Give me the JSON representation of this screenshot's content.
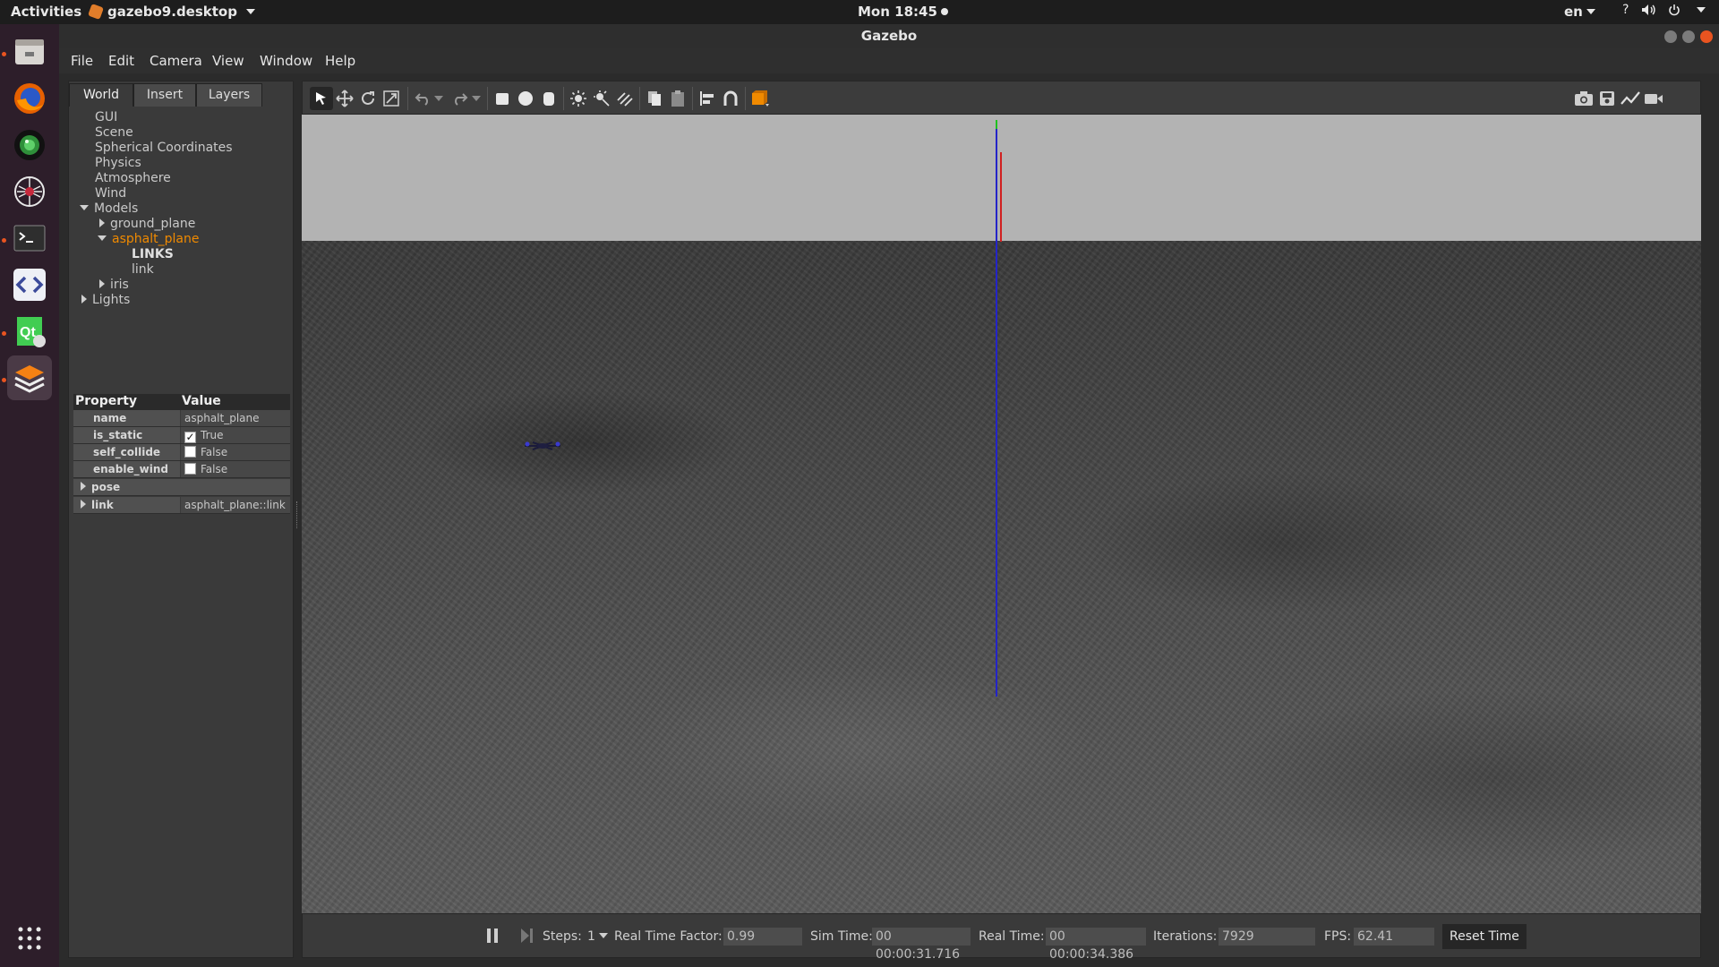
{
  "topbar": {
    "activities": "Activities",
    "app_name": "gazebo9.desktop",
    "clock": "Mon 18:45",
    "lang": "en",
    "help": "?"
  },
  "dock": {
    "items": [
      "files-icon",
      "firefox-icon",
      "camera-app-icon",
      "network-tool-icon",
      "terminal-icon",
      "code-editor-icon",
      "qt-creator-icon",
      "gazebo-icon"
    ],
    "show_apps": "show-applications-icon"
  },
  "window": {
    "title": "Gazebo"
  },
  "menu": [
    "File",
    "Edit",
    "Camera",
    "View",
    "Window",
    "Help"
  ],
  "left_panel": {
    "tabs": [
      "World",
      "Insert",
      "Layers"
    ],
    "tree": {
      "gui": "GUI",
      "scene": "Scene",
      "spherical": "Spherical Coordinates",
      "physics": "Physics",
      "atmosphere": "Atmosphere",
      "wind": "Wind",
      "models": "Models",
      "ground_plane": "ground_plane",
      "asphalt_plane": "asphalt_plane",
      "links_header": "LINKS",
      "link": "link",
      "iris": "iris",
      "lights": "Lights"
    },
    "properties": {
      "header_property": "Property",
      "header_value": "Value",
      "rows": [
        {
          "name": "name",
          "value": "asphalt_plane"
        },
        {
          "name": "is_static",
          "value": "True",
          "checked": "✓"
        },
        {
          "name": "self_collide",
          "value": "False"
        },
        {
          "name": "enable_wind",
          "value": "False"
        },
        {
          "name": "pose",
          "value": ""
        },
        {
          "name": "link",
          "value": "asphalt_plane::link"
        }
      ]
    }
  },
  "toolbar": {
    "left_icons": [
      "select-arrow-icon",
      "translate-icon",
      "rotate-icon",
      "scale-icon",
      "undo-icon",
      "redo-icon",
      "box-shape-icon",
      "sphere-shape-icon",
      "cylinder-shape-icon",
      "point-light-icon",
      "spot-light-icon",
      "directional-light-icon",
      "copy-icon",
      "paste-icon",
      "align-icon",
      "snap-icon",
      "change-view-icon"
    ],
    "right_icons": [
      "screenshot-icon",
      "log-icon",
      "plot-icon",
      "video-record-icon"
    ]
  },
  "bottom": {
    "steps_label": "Steps:",
    "steps_value": "1",
    "rtf_label": "Real Time Factor:",
    "rtf_value": "0.99",
    "sim_label": "Sim Time:",
    "sim_value": "00 00:00:31.716",
    "real_label": "Real Time:",
    "real_value": "00 00:00:34.386",
    "iter_label": "Iterations:",
    "iter_value": "7929",
    "fps_label": "FPS:",
    "fps_value": "62.41",
    "reset_label": "Reset Time"
  },
  "colors": {
    "selection": "#f08a00",
    "ubuntu_orange": "#e95420",
    "axis_z": "#2424c8",
    "axis_x": "#d02020"
  }
}
